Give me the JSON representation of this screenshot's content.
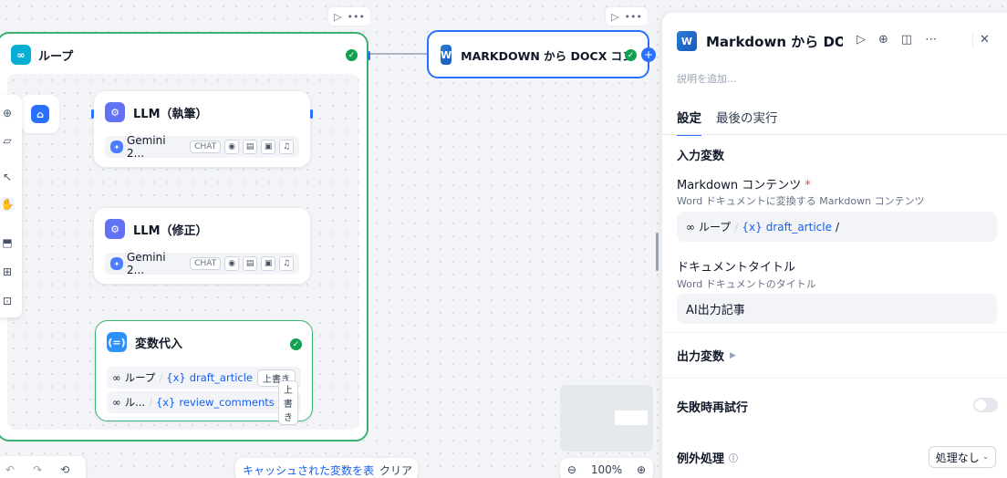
{
  "loop": {
    "title": "ループ"
  },
  "llm1": {
    "title": "LLM（執筆）",
    "model": "Gemini 2...",
    "mode": "CHAT"
  },
  "llm2": {
    "title": "LLM（修正）",
    "model": "Gemini 2...",
    "mode": "CHAT"
  },
  "assign": {
    "title": "変数代入",
    "rows": [
      {
        "scope": "ループ",
        "var": "draft_article",
        "op": "上書き"
      },
      {
        "scope": "ル...",
        "var": "review_comments",
        "op": "上書き"
      }
    ]
  },
  "docx_node": {
    "title": "MARKDOWN から DOCX コン"
  },
  "panel": {
    "title": "Markdown から DOCX",
    "description_placeholder": "説明を追加...",
    "tabs": [
      "設定",
      "最後の実行"
    ],
    "input_vars_heading": "入力変数",
    "md_label": "Markdown コンテンツ",
    "md_required": "*",
    "md_hint": "Word ドキュメントに変換する Markdown コンテンツ",
    "md_value": {
      "scope": "ループ",
      "var": "draft_article",
      "tail": "/"
    },
    "doc_title_label": "ドキュメントタイトル",
    "doc_title_hint": "Word ドキュメントのタイトル",
    "doc_title_value": "AI出力記事",
    "output_vars": "出力変数",
    "retry_label": "失敗時再試行",
    "exception_label": "例外処理",
    "exception_value": "処理なし"
  },
  "bottom": {
    "cache_link": "キャッシュされた変数を表示",
    "clear": "クリア",
    "zoom": "100%"
  },
  "colors": {
    "accent": "#2970ff",
    "success": "#12a150",
    "loop_border": "#3bb273"
  }
}
